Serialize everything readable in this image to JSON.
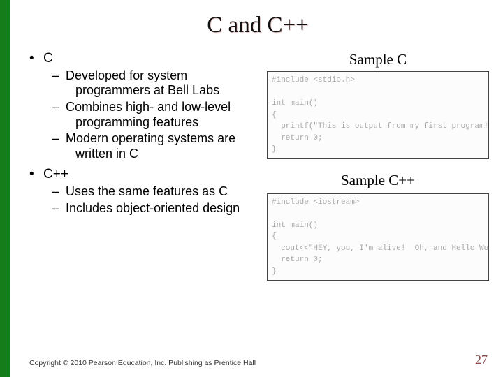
{
  "title": "C and C++",
  "left": {
    "c_label": "C",
    "c_points": [
      "Developed for system programmers at Bell Labs",
      "Combines high- and low-level programming features",
      "Modern operating systems are written in C"
    ],
    "cpp_label": "C++",
    "cpp_points": [
      "Uses the same features as C",
      "Includes object-oriented design"
    ]
  },
  "right": {
    "sample_c_label": "Sample C",
    "sample_c_code": "#include <stdio.h>\n\nint main()\n{\n  printf(\"This is output from my first program!\\n\");\n  return 0;\n}",
    "sample_cpp_label": "Sample C++",
    "sample_cpp_code": "#include <iostream>\n\nint main()\n{\n  cout<<\"HEY, you, I'm alive!  Oh, and Hello World!\";\n  return 0;\n}"
  },
  "footer": "Copyright © 2010 Pearson Education, Inc. Publishing as Prentice Hall",
  "page_number": "27"
}
